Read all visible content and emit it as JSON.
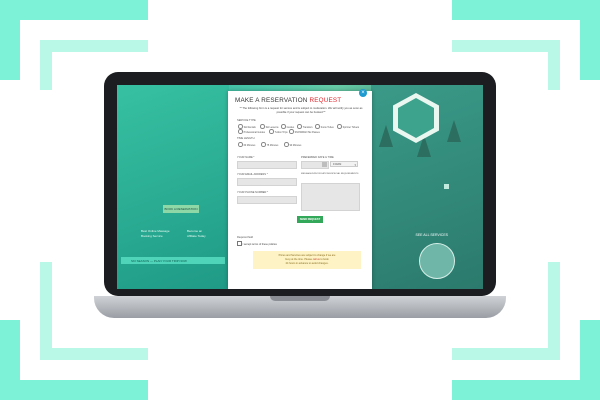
{
  "modal": {
    "title_prefix": "MAKE A RESERVATION",
    "title_accent": "REQUEST",
    "subtitle": "** The following form is a request for service and is subject to moderation. We will notify you as soon as possible if your request can be booked.**",
    "close_label": "×",
    "service_label": "SERVICE TYPE",
    "services": [
      "Ski Rentals",
      "Ski Lessons",
      "Guides",
      "Transfers",
      "Snow Tubes",
      "Sprinter Tickets",
      "Professional Guides",
      "Tuition Trips",
      "SNOWMAN Ski Passes"
    ],
    "time_label": "TIME LENGTH",
    "times": [
      "60 Minutes",
      "75 Minutes",
      "90 Minutes"
    ],
    "name_label": "YOUR NAME *",
    "date_label": "PREFERRED DATE & TIME",
    "time_value": "9:00AM",
    "email_label": "YOUR EMAIL ADDRESS *",
    "message_label": "MESSAGE/SPECIFICATIONS/SPECIAL REQUIREMENTS",
    "phone_label": "YOUR PHONE NUMBER *",
    "send_label": "SEND REQUEST",
    "required_label": "Required field",
    "agree_label": "I accept terms of these policies",
    "note_line1": "Prices and Services are subject to change if we are",
    "note_line2": "busy at the time. Please",
    "note_accent": "call us",
    "note_line3": "to book",
    "note_line4": "24 hours in advance to avoid changes."
  },
  "background": {
    "button_label": "BOOK A RESERVATION",
    "bar_text": "SKI SEASON — PLAN YOUR TRIP NOW",
    "link_text": "SEE ALL SERVICES",
    "left_text1": "Best Online Massage",
    "left_text2": "Booking Service",
    "left_text3": "Become an",
    "left_text4": "Affiliate Today"
  },
  "colors": {
    "accent_red": "#e2232a",
    "send_green": "#34a85a",
    "frame_mint": "#7ef2d6"
  }
}
